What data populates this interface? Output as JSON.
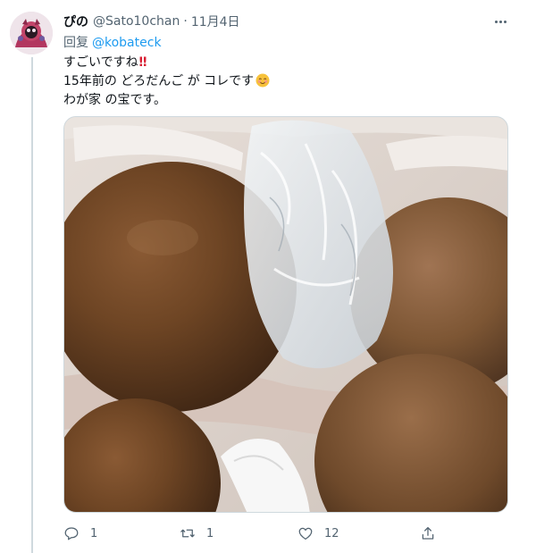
{
  "tweet": {
    "display_name": "ぴの",
    "handle": "@Sato10chan",
    "separator": "·",
    "date": "11月4日",
    "reply_prefix": "回复",
    "reply_to": "@kobateck",
    "lines": [
      "すごいですね",
      "15年前の どろだんご が コレです",
      "わが家 の宝です。"
    ],
    "line1_emoji": "‼",
    "image_description_icon": "photo",
    "counts": {
      "replies": "1",
      "retweets": "1",
      "likes": "12"
    }
  },
  "icons": {
    "more": "more-horizontal-icon",
    "reply": "reply-icon",
    "retweet": "retweet-icon",
    "like": "heart-icon",
    "share": "share-icon"
  },
  "colors": {
    "text": "#0f1419",
    "secondary": "#536471",
    "link": "#1d9bf0",
    "border": "#cfd9de"
  }
}
